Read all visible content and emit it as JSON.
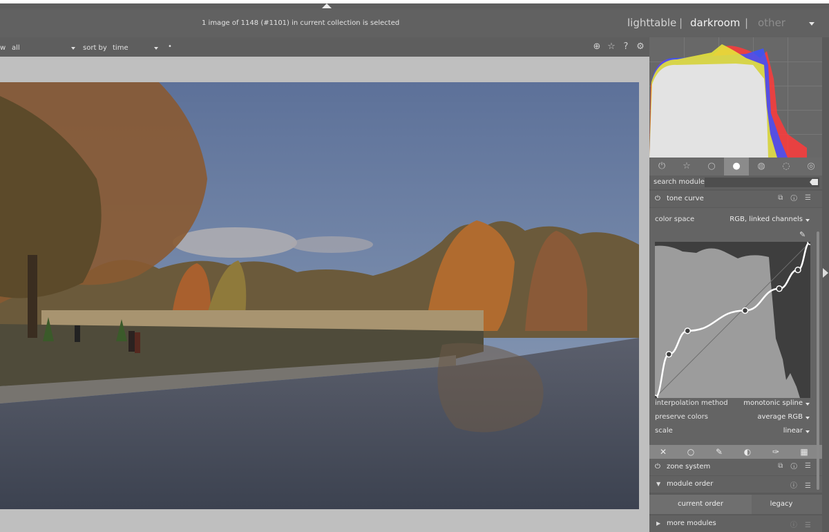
{
  "header": {
    "status": "1 image of 1148 (#1101) in current collection is selected",
    "views": [
      "lighttable",
      "darkroom",
      "other"
    ],
    "separators": [
      "|",
      "|"
    ]
  },
  "filterbar": {
    "view_prefix": "w",
    "filter_value": "all",
    "sort_label": "sort by",
    "sort_value": "time",
    "sort_extra": "•",
    "icons": [
      "grouping-icon",
      "star-icon",
      "help-icon",
      "preferences-gear-icon"
    ],
    "icon_glyphs": [
      "⊕",
      "☆",
      "?",
      "⚙"
    ]
  },
  "module_groups": {
    "icons": [
      "power-icon",
      "favorite-star-icon",
      "base-circle-icon",
      "tone-icon",
      "color-icon",
      "correct-icon",
      "effect-icon"
    ],
    "glyphs": [
      "⏻",
      "☆",
      "○",
      "●",
      "◍",
      "◌",
      "◎"
    ],
    "active_index": 3
  },
  "search": {
    "label": "search module",
    "value": ""
  },
  "tone_curve": {
    "title": "tone curve",
    "color_space_label": "color space",
    "color_space_value": "RGB, linked channels",
    "interpolation_label": "interpolation method",
    "interpolation_value": "monotonic spline",
    "preserve_label": "preserve colors",
    "preserve_value": "average RGB",
    "scale_label": "scale",
    "scale_value": "linear",
    "curve_points": [
      [
        0.0,
        0.0
      ],
      [
        0.09,
        0.28
      ],
      [
        0.21,
        0.43
      ],
      [
        0.58,
        0.56
      ],
      [
        0.8,
        0.7
      ],
      [
        0.92,
        0.82
      ],
      [
        1.0,
        1.0
      ]
    ],
    "picker_glyph": "✎",
    "tool_glyphs": [
      "✕",
      "○",
      "✎",
      "◐",
      "✑",
      "▦"
    ]
  },
  "zone_system": {
    "title": "zone system"
  },
  "module_order": {
    "title": "module order",
    "current": "current order",
    "legacy": "legacy"
  },
  "more_modules": {
    "title": "more modules"
  },
  "header_icons": "⧉ ⓘ ☰",
  "header_icons_short": "ⓘ ☰",
  "triangle_down": "▼",
  "triangle_right": "▶",
  "power_glyph": "⏻"
}
